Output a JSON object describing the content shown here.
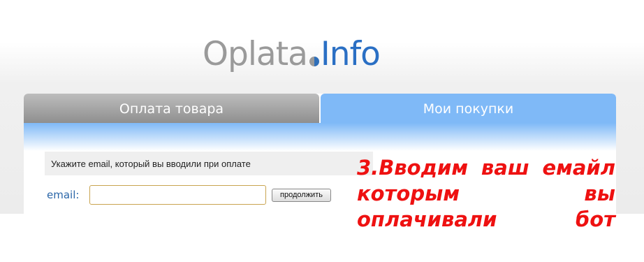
{
  "logo": {
    "part1": "Oplata",
    "part2": "Info"
  },
  "tabs": [
    {
      "label": "Оплата товара",
      "active": false
    },
    {
      "label": "Мои покупки",
      "active": true
    }
  ],
  "form": {
    "hint": "Укажите email, который вы вводили при оплате",
    "email_label": "email:",
    "email_value": "",
    "email_placeholder": "",
    "continue_label": "продолжить"
  },
  "annotation": {
    "line1": "3.Вводим ваш емайл",
    "line2": "которым вы",
    "line3": "оплачивали бот"
  },
  "colors": {
    "accent_blue": "#7fb9f7",
    "logo_blue": "#2a6fc4",
    "annotation_red": "#ee1111"
  }
}
